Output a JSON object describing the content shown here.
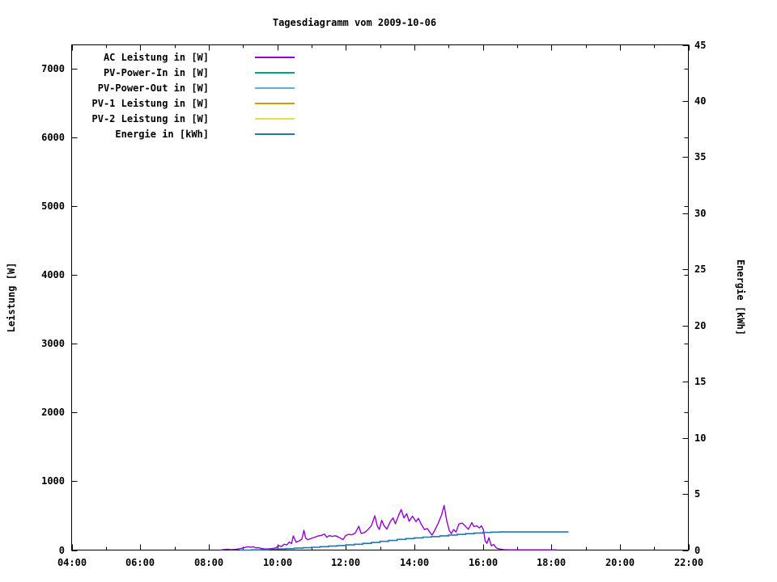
{
  "title": "Tagesdiagramm vom 2009-10-06",
  "axes": {
    "left_label": "Leistung [W]",
    "right_label": "Energie [kWh]"
  },
  "legend": {
    "items": [
      {
        "label": "AC Leistung in [W]",
        "color": "#9400d3"
      },
      {
        "label": "PV-Power-In in [W]",
        "color": "#00a28a"
      },
      {
        "label": "PV-Power-Out in [W]",
        "color": "#55b0e8"
      },
      {
        "label": "PV-1 Leistung in [W]",
        "color": "#dd9800"
      },
      {
        "label": "PV-2 Leistung in [W]",
        "color": "#e6dc50"
      },
      {
        "label": "Energie in [kWh]",
        "color": "#1f77b4"
      }
    ]
  },
  "chart_data": {
    "type": "line",
    "title": "Tagesdiagramm vom 2009-10-06",
    "x_axis": {
      "unit": "time of day (hours)",
      "range": [
        4,
        22
      ],
      "major_tick_hours": [
        4,
        6,
        8,
        10,
        12,
        14,
        16,
        18,
        20,
        22
      ],
      "major_tick_labels": [
        "04:00",
        "06:00",
        "08:00",
        "10:00",
        "12:00",
        "14:00",
        "16:00",
        "18:00",
        "20:00",
        "22:00"
      ],
      "minor_tick_hours": [
        5,
        7,
        9,
        11,
        13,
        15,
        17,
        19,
        21
      ]
    },
    "y_left": {
      "label": "Leistung [W]",
      "range": [
        0,
        7350
      ],
      "tick_values": [
        0,
        1000,
        2000,
        3000,
        4000,
        5000,
        6000,
        7000
      ],
      "tick_labels": [
        "0",
        "1000",
        "2000",
        "3000",
        "4000",
        "5000",
        "6000",
        "7000"
      ]
    },
    "y_right": {
      "label": "Energie [kWh]",
      "range": [
        0,
        45
      ],
      "tick_values": [
        0,
        5,
        10,
        15,
        20,
        25,
        30,
        35,
        40,
        45
      ],
      "tick_labels": [
        "0",
        "5",
        "10",
        "15",
        "20",
        "25",
        "30",
        "35",
        "40",
        "45"
      ]
    },
    "grid": false,
    "legend_position": "top-left-inside",
    "series": [
      {
        "name": "AC Leistung in [W]",
        "color": "#9400d3",
        "axis": "left",
        "style": "line",
        "points": [
          [
            8.35,
            0
          ],
          [
            8.45,
            8
          ],
          [
            8.55,
            12
          ],
          [
            8.65,
            6
          ],
          [
            8.8,
            10
          ],
          [
            8.95,
            25
          ],
          [
            9.05,
            38
          ],
          [
            9.15,
            48
          ],
          [
            9.22,
            42
          ],
          [
            9.3,
            48
          ],
          [
            9.38,
            30
          ],
          [
            9.45,
            35
          ],
          [
            9.55,
            22
          ],
          [
            9.65,
            15
          ],
          [
            9.75,
            18
          ],
          [
            9.85,
            22
          ],
          [
            9.95,
            30
          ],
          [
            10.05,
            65
          ],
          [
            10.12,
            50
          ],
          [
            10.2,
            85
          ],
          [
            10.28,
            75
          ],
          [
            10.35,
            115
          ],
          [
            10.42,
            95
          ],
          [
            10.47,
            205
          ],
          [
            10.55,
            115
          ],
          [
            10.65,
            135
          ],
          [
            10.72,
            160
          ],
          [
            10.78,
            288
          ],
          [
            10.83,
            175
          ],
          [
            10.9,
            150
          ],
          [
            11.0,
            170
          ],
          [
            11.1,
            188
          ],
          [
            11.2,
            205
          ],
          [
            11.3,
            215
          ],
          [
            11.38,
            232
          ],
          [
            11.45,
            185
          ],
          [
            11.52,
            210
          ],
          [
            11.6,
            198
          ],
          [
            11.7,
            208
          ],
          [
            11.8,
            185
          ],
          [
            11.92,
            152
          ],
          [
            12.0,
            212
          ],
          [
            12.08,
            228
          ],
          [
            12.18,
            222
          ],
          [
            12.28,
            248
          ],
          [
            12.38,
            345
          ],
          [
            12.45,
            242
          ],
          [
            12.55,
            255
          ],
          [
            12.65,
            298
          ],
          [
            12.75,
            355
          ],
          [
            12.85,
            498
          ],
          [
            12.92,
            352
          ],
          [
            12.98,
            300
          ],
          [
            13.05,
            432
          ],
          [
            13.12,
            352
          ],
          [
            13.2,
            305
          ],
          [
            13.3,
            412
          ],
          [
            13.38,
            468
          ],
          [
            13.45,
            382
          ],
          [
            13.55,
            515
          ],
          [
            13.62,
            588
          ],
          [
            13.7,
            468
          ],
          [
            13.78,
            528
          ],
          [
            13.85,
            418
          ],
          [
            13.95,
            492
          ],
          [
            14.05,
            412
          ],
          [
            14.12,
            462
          ],
          [
            14.2,
            378
          ],
          [
            14.3,
            298
          ],
          [
            14.38,
            312
          ],
          [
            14.45,
            262
          ],
          [
            14.52,
            218
          ],
          [
            14.6,
            288
          ],
          [
            14.7,
            392
          ],
          [
            14.8,
            515
          ],
          [
            14.87,
            648
          ],
          [
            14.95,
            425
          ],
          [
            15.02,
            288
          ],
          [
            15.08,
            238
          ],
          [
            15.15,
            298
          ],
          [
            15.22,
            262
          ],
          [
            15.3,
            378
          ],
          [
            15.4,
            392
          ],
          [
            15.5,
            345
          ],
          [
            15.58,
            302
          ],
          [
            15.68,
            398
          ],
          [
            15.74,
            342
          ],
          [
            15.82,
            352
          ],
          [
            15.9,
            322
          ],
          [
            15.96,
            352
          ],
          [
            16.02,
            295
          ],
          [
            16.07,
            132
          ],
          [
            16.12,
            98
          ],
          [
            16.18,
            178
          ],
          [
            16.25,
            62
          ],
          [
            16.32,
            82
          ],
          [
            16.4,
            28
          ],
          [
            16.5,
            14
          ],
          [
            16.62,
            6
          ],
          [
            16.8,
            4
          ],
          [
            17.2,
            4
          ],
          [
            17.6,
            4
          ],
          [
            18.0,
            4
          ],
          [
            18.15,
            3
          ]
        ]
      },
      {
        "name": "PV-Power-In in [W]",
        "color": "#00a28a",
        "axis": "left",
        "style": "line",
        "points": []
      },
      {
        "name": "PV-Power-Out in [W]",
        "color": "#55b0e8",
        "axis": "left",
        "style": "line",
        "points": []
      },
      {
        "name": "PV-1 Leistung in [W]",
        "color": "#dd9800",
        "axis": "left",
        "style": "line",
        "points": []
      },
      {
        "name": "PV-2 Leistung in [W]",
        "color": "#e6dc50",
        "axis": "left",
        "style": "line",
        "points": []
      },
      {
        "name": "Energie in [kWh]",
        "color": "#1f77b4",
        "axis": "right",
        "style": "steps",
        "points": [
          [
            8.9,
            0.0
          ],
          [
            9.25,
            0.02
          ],
          [
            9.5,
            0.04
          ],
          [
            9.75,
            0.07
          ],
          [
            10.0,
            0.1
          ],
          [
            10.25,
            0.13
          ],
          [
            10.5,
            0.17
          ],
          [
            10.75,
            0.21
          ],
          [
            11.0,
            0.25
          ],
          [
            11.25,
            0.3
          ],
          [
            11.5,
            0.35
          ],
          [
            11.75,
            0.4
          ],
          [
            12.0,
            0.46
          ],
          [
            12.25,
            0.52
          ],
          [
            12.5,
            0.6
          ],
          [
            12.75,
            0.68
          ],
          [
            13.0,
            0.78
          ],
          [
            13.25,
            0.86
          ],
          [
            13.5,
            0.95
          ],
          [
            13.75,
            1.02
          ],
          [
            14.0,
            1.09
          ],
          [
            14.25,
            1.15
          ],
          [
            14.5,
            1.2
          ],
          [
            14.75,
            1.27
          ],
          [
            15.0,
            1.34
          ],
          [
            15.25,
            1.4
          ],
          [
            15.5,
            1.46
          ],
          [
            15.75,
            1.52
          ],
          [
            16.0,
            1.57
          ],
          [
            16.25,
            1.6
          ],
          [
            16.5,
            1.61
          ],
          [
            18.5,
            1.61
          ]
        ]
      }
    ]
  }
}
